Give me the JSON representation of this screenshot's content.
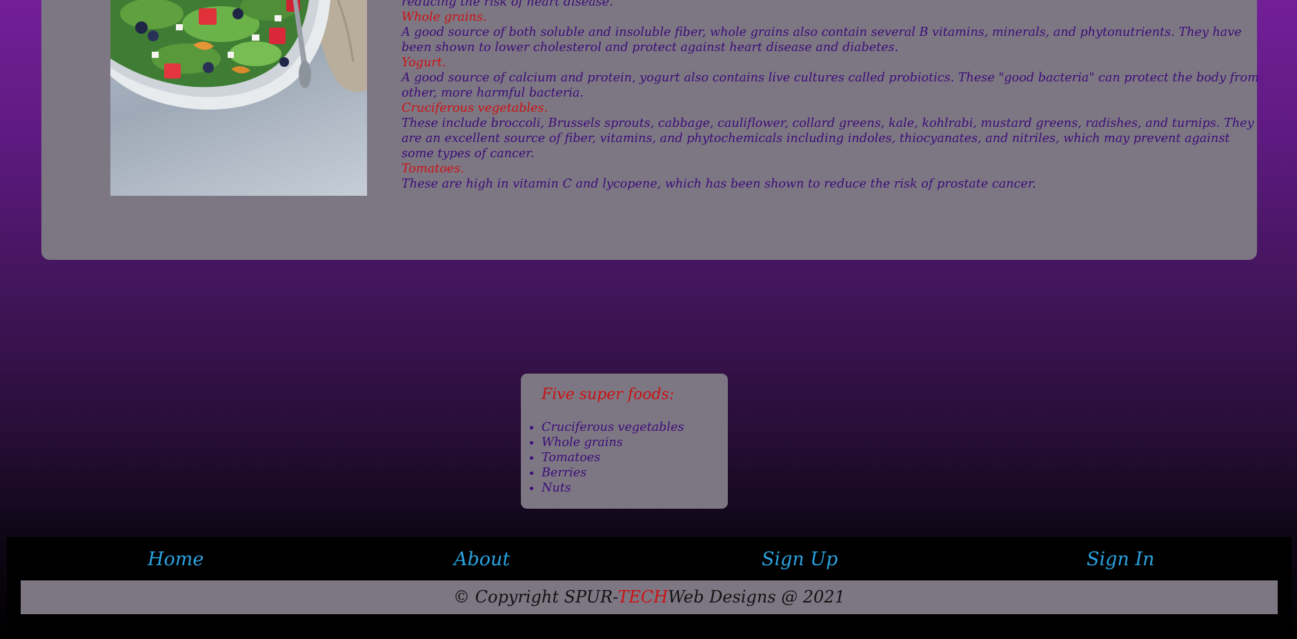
{
  "article": {
    "intro_tail": "reducing the risk of heart disease.",
    "foods": [
      {
        "name": "Whole grains.",
        "text": "A good source of both soluble and insoluble fiber, whole grains also contain several B vitamins, minerals, and phytonutrients. They have been shown to lower cholesterol and protect against heart disease and diabetes."
      },
      {
        "name": "Yogurt.",
        "text": "A good source of calcium and protein, yogurt also contains live cultures called probiotics. These \"good bacteria\" can protect the body from other, more harmful bacteria."
      },
      {
        "name": "Cruciferous vegetables.",
        "text": "These include broccoli, Brussels sprouts, cabbage, cauliflower, collard greens, kale, kohlrabi, mustard greens, radishes, and turnips. They are an excellent source of fiber, vitamins, and phytochemicals including indoles, thiocyanates, and nitriles, which may prevent against some types of cancer."
      },
      {
        "name": "Tomatoes.",
        "text": "These are high in vitamin C and lycopene, which has been shown to reduce the risk of prostate cancer."
      }
    ]
  },
  "superfoods": {
    "title": "Five super foods:",
    "items": [
      "Cruciferous vegetables",
      "Whole grains",
      "Tomatoes",
      "Berries",
      "Nuts"
    ]
  },
  "nav": {
    "home": "Home",
    "about": "About",
    "signup": "Sign Up",
    "signin": "Sign In"
  },
  "copyright": {
    "prefix": "© Copyright SPUR-",
    "highlight": "TECH",
    "suffix": "Web Designs @ 2021"
  },
  "colors": {
    "accent_red": "#cc1111",
    "text_purple": "#3d0c78",
    "link_blue": "#2aa3e0",
    "card_gray": "#7d7784"
  },
  "icons": {
    "image": "salad-bowl-image"
  }
}
